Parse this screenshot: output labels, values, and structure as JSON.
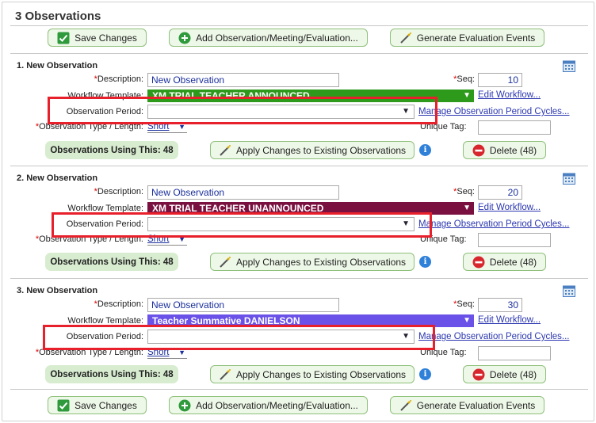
{
  "page": {
    "title": "3 Observations"
  },
  "toolbar": {
    "save_label": "Save Changes",
    "add_label": "Add Observation/Meeting/Evaluation...",
    "generate_label": "Generate Evaluation Events"
  },
  "labels": {
    "description": "Description:",
    "seq": "Seq:",
    "workflow_template": "Workflow Template:",
    "observation_period": "Observation Period:",
    "observation_type": "Observation Type / Length:",
    "unique_tag": "Unique Tag:",
    "required_mark": "*",
    "edit_workflow": "Edit Workflow...",
    "manage_cycles": "Manage Observation Period Cycles...",
    "apply_changes": "Apply Changes to Existing Observations"
  },
  "observations": [
    {
      "title": "1. New Observation",
      "description": "New Observation",
      "seq": "10",
      "template": "XM TRIAL TEACHER ANNOUNCED",
      "template_color": "#2e9a1c",
      "period": "",
      "type": "Short",
      "unique_tag": "",
      "using": "Observations Using This: 48",
      "delete_label": "Delete (48)"
    },
    {
      "title": "2. New Observation",
      "description": "New Observation",
      "seq": "20",
      "template": "XM TRIAL TEACHER UNANNOUNCED",
      "template_color": "#7a1040",
      "period": "",
      "type": "Short",
      "unique_tag": "",
      "using": "Observations Using This: 48",
      "delete_label": "Delete (48)"
    },
    {
      "title": "3. New Observation",
      "description": "New Observation",
      "seq": "30",
      "template": "Teacher Summative DANIELSON",
      "template_color": "#6a52e8",
      "period": "",
      "type": "Short",
      "unique_tag": "",
      "using": "Observations Using This: 48",
      "delete_label": "Delete (48)"
    }
  ],
  "colors": {
    "accent_green": "#eef8e8",
    "highlight_red": "#e8202c",
    "delete_red": "#d7262e"
  },
  "icons": [
    "check-icon",
    "plus-circle-icon",
    "wand-icon",
    "calendar-icon",
    "info-icon",
    "minus-circle-icon",
    "chevron-down-icon"
  ]
}
